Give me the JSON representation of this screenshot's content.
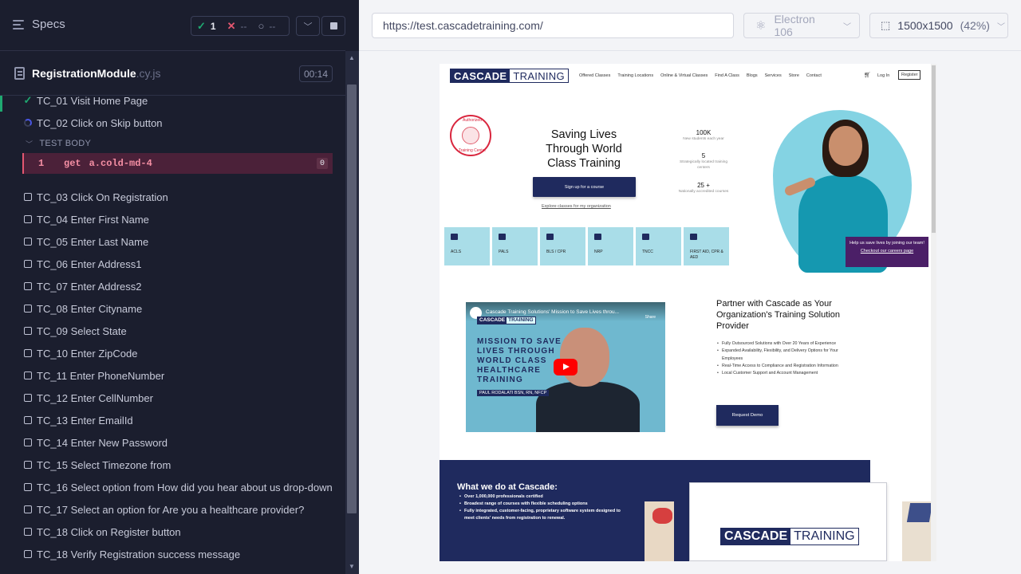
{
  "runner": {
    "specs_label": "Specs",
    "stats": {
      "passed": "1",
      "failed": "--",
      "pending": "--"
    },
    "spec": {
      "name": "RegistrationModule",
      "ext": ".cy.js",
      "duration": "00:14"
    },
    "tests": [
      {
        "title": "TC_01 Visit Home Page",
        "state": "passed"
      },
      {
        "title": "TC_02 Click on Skip button",
        "state": "running"
      },
      {
        "title": "TC_03 Click On Registration",
        "state": "queued"
      },
      {
        "title": "TC_04 Enter First Name",
        "state": "queued"
      },
      {
        "title": "TC_05 Enter Last Name",
        "state": "queued"
      },
      {
        "title": "TC_06 Enter Address1",
        "state": "queued"
      },
      {
        "title": "TC_07 Enter Address2",
        "state": "queued"
      },
      {
        "title": "TC_08 Enter Cityname",
        "state": "queued"
      },
      {
        "title": "TC_09 Select State",
        "state": "queued"
      },
      {
        "title": "TC_10 Enter ZipCode",
        "state": "queued"
      },
      {
        "title": "TC_11 Enter PhoneNumber",
        "state": "queued"
      },
      {
        "title": "TC_12 Enter CellNumber",
        "state": "queued"
      },
      {
        "title": "TC_13 Enter EmailId",
        "state": "queued"
      },
      {
        "title": "TC_14 Enter New Password",
        "state": "queued"
      },
      {
        "title": "TC_15 Select Timezone from",
        "state": "queued"
      },
      {
        "title": "TC_16 Select option from How did you hear about us drop-down",
        "state": "queued"
      },
      {
        "title": "TC_17 Select an option for Are you a healthcare provider?",
        "state": "queued"
      },
      {
        "title": "TC_18 Click on Register button",
        "state": "queued"
      },
      {
        "title": "TC_18 Verify Registration success message",
        "state": "queued"
      }
    ],
    "test_body_label": "TEST BODY",
    "command": {
      "num": "1",
      "name": "get",
      "selector": "a.cold-md-4",
      "count": "0"
    }
  },
  "aut": {
    "url": "https://test.cascadetraining.com/",
    "browser": "Electron 106",
    "viewport": "1500x1500",
    "scale": "(42%)"
  },
  "site": {
    "logo_a": "CASCADE",
    "logo_b": "TRAINING",
    "nav": [
      "Offered Classes",
      "Training Locations",
      "Online & Virtual Classes",
      "Find A Class",
      "Blogs",
      "Services",
      "Store",
      "Contact"
    ],
    "login": "Log In",
    "register": "Register",
    "badge_top": "Authorized",
    "badge_bottom": "Training Center",
    "hero_title": "Saving Lives Through World Class Training",
    "signup": "Sign up for a course",
    "explore": "Explore classes for my organization",
    "stats": [
      {
        "num": "100K",
        "label": "New students each year"
      },
      {
        "num": "5",
        "label": "Strategically located training centers"
      },
      {
        "num": "25 +",
        "label": "Nationally accredited courses"
      }
    ],
    "cards": [
      "ACLS",
      "PALS",
      "BLS / CPR",
      "NRP",
      "TNCC",
      "FIRST AID, CPR & AED"
    ],
    "help_line1": "Help us save lives by joining our team!",
    "help_link": "Checkout our careers page",
    "video": {
      "title": "Cascade Training Solutions' Mission to Save Lives throu...",
      "share": "Share",
      "text": "MISSION TO SAVE LIVES THROUGH WORLD CLASS HEALTHCARE TRAINING",
      "name": "PAUL RODALATI BSN, RN, NFCP"
    },
    "partner_title": "Partner with Cascade as Your Organization's Training Solution Provider",
    "partner_bullets": [
      "Fully Outsourced Solutions with Over 20 Years of Experience",
      "Expanded Availability, Flexibility, and Delivery Options for Your Employees",
      "Real-Time Access to Compliance and Registration Information",
      "Local Customer Support and Account Management"
    ],
    "demo": "Request Demo",
    "what_title": "What we do at Cascade:",
    "what_bullets": [
      "Over 1,000,000 professionals certified",
      "Broadest range of courses with flexible scheduling options",
      "Fully integrated, customer-facing, proprietary software system designed to meet clients' needs from registration to renewal."
    ]
  }
}
